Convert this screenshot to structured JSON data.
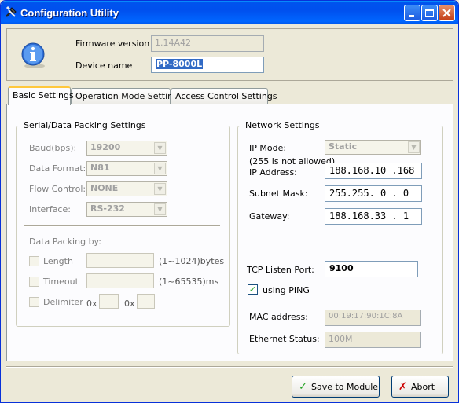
{
  "window": {
    "title": "Configuration Utility"
  },
  "header": {
    "firmware_label": "Firmware version",
    "firmware_value": "1.14A42",
    "device_name_label": "Device name",
    "device_name_value": "PP-8000L"
  },
  "tabs": [
    {
      "label": "Basic Settings"
    },
    {
      "label": "Operation Mode Settings"
    },
    {
      "label": "Access Control Settings"
    }
  ],
  "serial": {
    "title": "Serial/Data Packing Settings",
    "baud_label": "Baud(bps):",
    "baud_value": "19200",
    "format_label": "Data Format:",
    "format_value": "N81",
    "flow_label": "Flow Control:",
    "flow_value": "NONE",
    "interface_label": "Interface:",
    "interface_value": "RS-232",
    "packing_label": "Data Packing by:",
    "length_label": "Length",
    "length_range": "(1~1024)bytes",
    "timeout_label": "Timeout",
    "timeout_range": "(1~65535)ms",
    "delimiter_label": "Delimiter",
    "hex_prefix_1": "0x",
    "hex_prefix_2": "0x"
  },
  "network": {
    "title": "Network Settings",
    "ip_mode_label": "IP Mode:",
    "ip_mode_value": "Static",
    "note": "(255 is not allowed)",
    "ip_label": "IP Address:",
    "ip_value": "188.168.10 .168",
    "mask_label": "Subnet Mask:",
    "mask_value": "255.255. 0 . 0",
    "gateway_label": "Gateway:",
    "gateway_value": "188.168.33 . 1",
    "tcp_label": "TCP Listen Port:",
    "tcp_value": "9100",
    "ping_label": "using PING",
    "mac_label": "MAC address:",
    "mac_value": "00:19:17:90:1C:8A",
    "eth_label": "Ethernet Status:",
    "eth_value": "100M"
  },
  "buttons": {
    "save": "Save to Module",
    "abort": "Abort"
  },
  "colors": {
    "title_bar": "#0055e8",
    "save_icon": "#21a121",
    "abort_icon": "#cc0000"
  }
}
